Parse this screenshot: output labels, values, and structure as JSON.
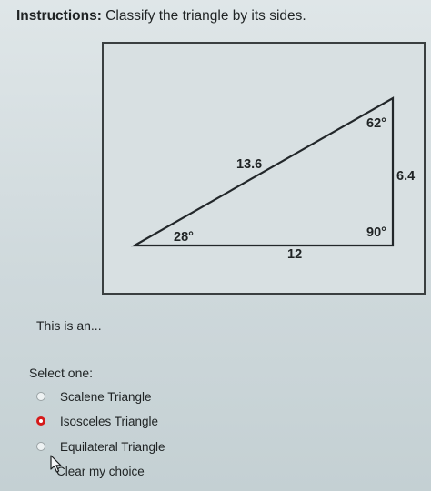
{
  "instructions": {
    "lead": "Instructions:",
    "text": " Classify the triangle by its sides."
  },
  "figure": {
    "angle_top": "62°",
    "angle_right": "90°",
    "angle_left": "28°",
    "side_hypotenuse": "13.6",
    "side_vertical": "6.4",
    "side_base": "12"
  },
  "question": {
    "prompt": "This is an...",
    "select_label": "Select one:",
    "options": [
      {
        "label": "Scalene Triangle",
        "selected": false
      },
      {
        "label": "Isosceles Triangle",
        "selected": true
      },
      {
        "label": "Equilateral Triangle",
        "selected": false
      }
    ],
    "clear_label": "Clear my choice"
  },
  "colors": {
    "selected_radio": "#d51a1a",
    "background": "#d6dfe1"
  }
}
